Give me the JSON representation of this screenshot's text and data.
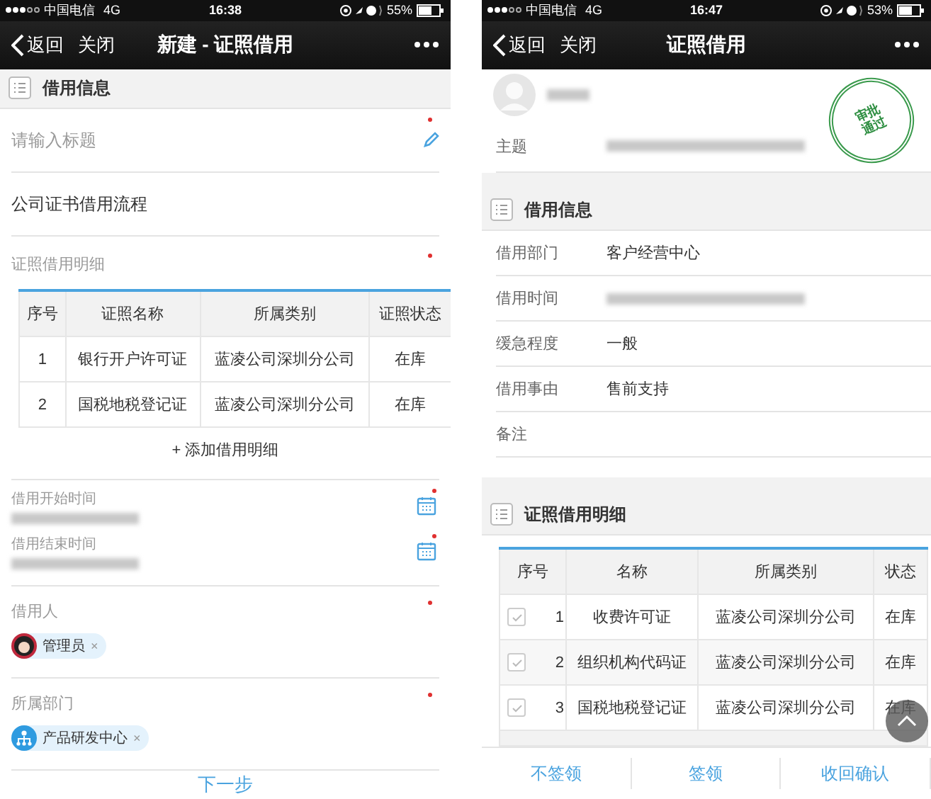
{
  "screens": [
    {
      "kind": "form",
      "status_bar": {
        "carrier": "中国电信",
        "network": "4G",
        "time": "16:38",
        "battery": "55%"
      },
      "nav": {
        "back": "返回",
        "close": "关闭",
        "title": "新建 - 证照借用"
      },
      "section": "借用信息",
      "title_field": {
        "placeholder": "请输入标题",
        "required": true
      },
      "flow_field": {
        "value": "公司证书借用流程"
      },
      "detail": {
        "label": "证照借用明细",
        "required": true,
        "columns": [
          "序号",
          "证照名称",
          "所属类别",
          "证照状态"
        ],
        "rows": [
          [
            "1",
            "银行开户许可证",
            "蓝凌公司深圳分公司",
            "在库"
          ],
          [
            "2",
            "国税地税登记证",
            "蓝凌公司深圳分公司",
            "在库"
          ]
        ],
        "add": "+ 添加借用明细"
      },
      "dates": [
        {
          "label": "借用开始时间",
          "required": true
        },
        {
          "label": "借用结束时间",
          "required": true
        }
      ],
      "people": [
        {
          "label": "借用人",
          "required": true,
          "chip": "管理员",
          "kind": "person",
          "remove": "×"
        },
        {
          "label": "所属部门",
          "required": true,
          "chip": "产品研发中心",
          "kind": "org",
          "remove": "×"
        }
      ],
      "footer": "下一步"
    },
    {
      "kind": "detail",
      "status_bar": {
        "carrier": "中国电信",
        "network": "4G",
        "time": "16:47",
        "battery": "53%"
      },
      "nav": {
        "back": "返回",
        "close": "关闭",
        "title": "证照借用"
      },
      "subject": {
        "label": "主题",
        "redacted": true
      },
      "stamp": [
        "审批",
        "通过"
      ],
      "section": "借用信息",
      "fields": [
        {
          "label": "借用部门",
          "value": "客户经营中心",
          "redacted": false
        },
        {
          "label": "借用时间",
          "redacted": true
        },
        {
          "label": "缓急程度",
          "value": "一般",
          "redacted": false
        },
        {
          "label": "借用事由",
          "value": "售前支持",
          "redacted": false
        },
        {
          "label": "备注",
          "redacted": false
        }
      ],
      "section2": "证照借用明细",
      "table": {
        "columns": [
          "序号",
          "名称",
          "所属类别",
          "状态"
        ],
        "rows": [
          {
            "checked": true,
            "cells": [
              "1",
              "收费许可证",
              "蓝凌公司深圳分公司",
              "在库"
            ]
          },
          {
            "checked": true,
            "cells": [
              "2",
              "组织机构代码证",
              "蓝凌公司深圳分公司",
              "在库"
            ]
          },
          {
            "checked": true,
            "cells": [
              "3",
              "国税地税登记证",
              "蓝凌公司深圳分公司",
              "在库"
            ]
          }
        ]
      },
      "actions": [
        "不签领",
        "签领",
        "收回确认"
      ]
    }
  ]
}
